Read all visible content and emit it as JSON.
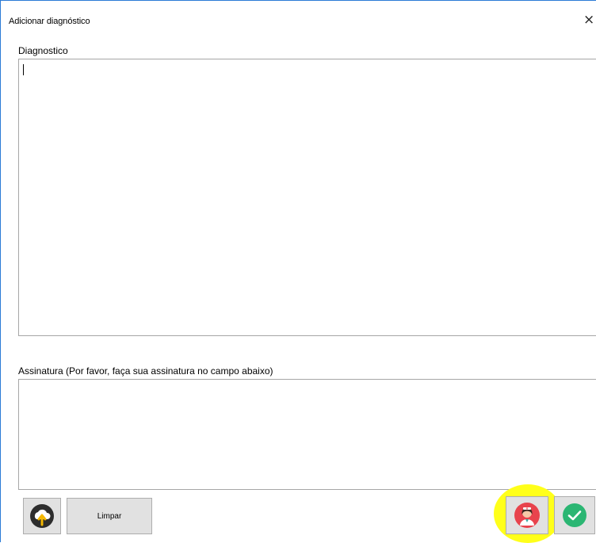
{
  "window": {
    "title": "Adicionar diagnóstico",
    "close_glyph": "×"
  },
  "diagnosis": {
    "label": "Diagnostico",
    "value": ""
  },
  "signature": {
    "label": "Assinatura (Por favor, faça sua assinatura no campo abaixo)"
  },
  "toolbar": {
    "upload_icon": "cloud-upload-icon",
    "clear_label": "Limpar",
    "profile_icon": "doctor-avatar-icon",
    "confirm_icon": "check-circle-icon"
  },
  "colors": {
    "window_border": "#2b7bd6",
    "highlight": "#ffff1a",
    "confirm_green": "#2bb673",
    "avatar_bg": "#e8434d"
  }
}
